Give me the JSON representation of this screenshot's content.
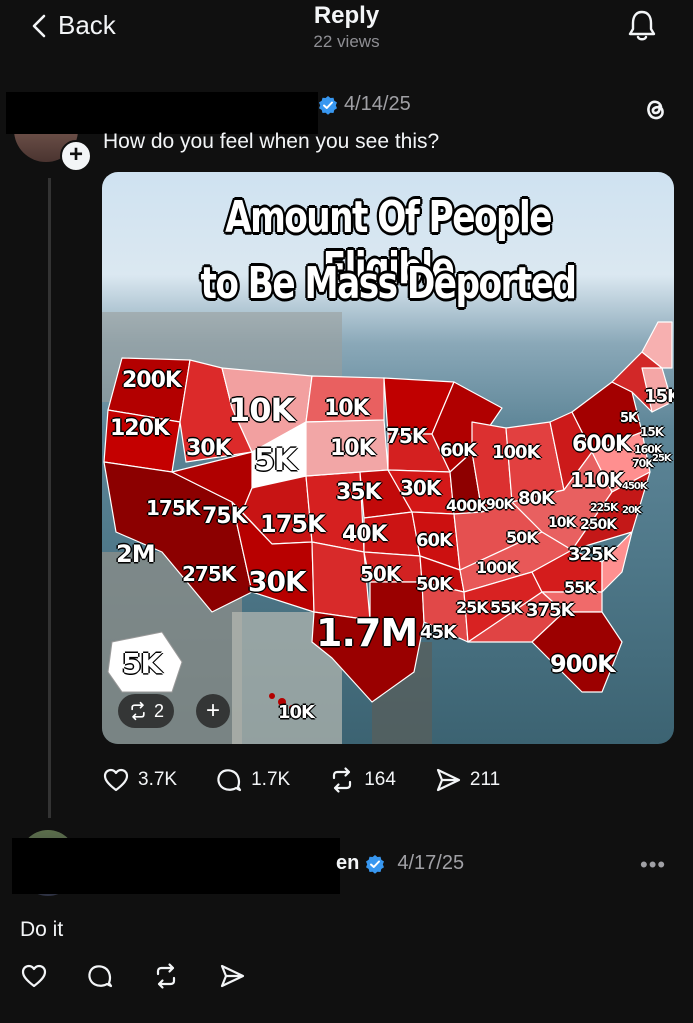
{
  "header": {
    "back_label": "Back",
    "title": "Reply",
    "views": "22 views"
  },
  "post1": {
    "date": "4/14/25",
    "text": "How do you feel when you see this?",
    "image": {
      "title_line1": "Amount Of People Eligible",
      "title_line2": "to Be Mass Deported",
      "labels": [
        "200K",
        "10K",
        "10K",
        "15K",
        "5K",
        "15K",
        "120K",
        "30K",
        "5K",
        "10K",
        "75K",
        "60K",
        "100K",
        "600K",
        "160K",
        "70K",
        "25K",
        "110K",
        "450K",
        "175K",
        "75K",
        "175K",
        "35K",
        "30K",
        "400K",
        "90K",
        "80K",
        "225K",
        "20K",
        "10K",
        "250K",
        "2M",
        "40K",
        "60K",
        "50K",
        "325K",
        "275K",
        "30K",
        "50K",
        "50K",
        "100K",
        "55K",
        "1.7M",
        "45K",
        "25K",
        "55K",
        "375K",
        "900K",
        "5K",
        "10K"
      ],
      "repost_count": "2"
    },
    "actions": {
      "likes": "3.7K",
      "replies": "1.7K",
      "reposts": "164",
      "shares": "211"
    }
  },
  "post2": {
    "name_fragment": "en",
    "date": "4/17/25",
    "text": "Do it"
  },
  "colors": {
    "background": "#101010",
    "verified": "#3897f0",
    "map_dark": "#9e0000",
    "map_light": "#f4a6a6"
  }
}
